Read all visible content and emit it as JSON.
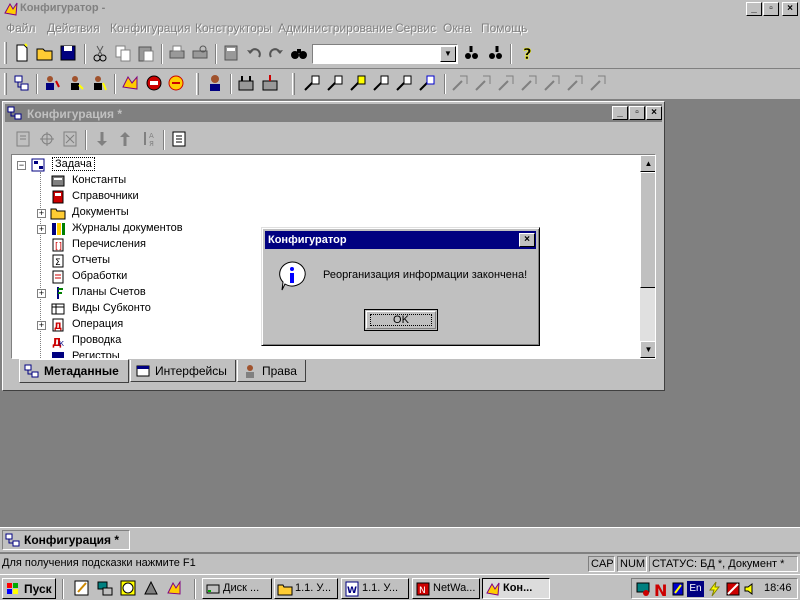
{
  "app": {
    "title": "Конфигуратор -"
  },
  "menu": [
    "Файл",
    "Действия",
    "Конфигурация",
    "Конструкторы",
    "Администрирование",
    "Сервис",
    "Окна",
    "Помощь"
  ],
  "icons": {
    "app": "app-icon",
    "new": "new-file-icon",
    "open": "open-folder-icon",
    "save": "save-icon",
    "cut": "cut-icon",
    "copy": "copy-icon",
    "paste": "paste-icon",
    "print": "print-icon",
    "find": "binoculars-icon",
    "help": "help-icon",
    "info": "info-icon"
  },
  "config_window": {
    "title": "Конфигурация *",
    "root": "Задача",
    "tree": [
      {
        "label": "Константы",
        "expandable": false
      },
      {
        "label": "Справочники",
        "expandable": false
      },
      {
        "label": "Документы",
        "expandable": true
      },
      {
        "label": "Журналы документов",
        "expandable": true
      },
      {
        "label": "Перечисления",
        "expandable": false
      },
      {
        "label": "Отчеты",
        "expandable": false
      },
      {
        "label": "Обработки",
        "expandable": false
      },
      {
        "label": "Планы Счетов",
        "expandable": true
      },
      {
        "label": "Виды Субконто",
        "expandable": false
      },
      {
        "label": "Операция",
        "expandable": true
      },
      {
        "label": "Проводка",
        "expandable": false
      },
      {
        "label": "Регистры",
        "expandable": false
      }
    ],
    "tabs": [
      "Метаданные",
      "Интерфейсы",
      "Права"
    ]
  },
  "dialog": {
    "title": "Конфигуратор",
    "message": "Реорганизация информации закончена!",
    "ok_label": "OK"
  },
  "mdi_tab": "Конфигурация *",
  "status": {
    "hint": "Для получения подсказки нажмите F1",
    "cap": "CAP",
    "num": "NUM",
    "db_status": "СТАТУС: БД *, Документ *"
  },
  "taskbar": {
    "start": "Пуск",
    "tasks": [
      "Диск ...",
      "1.1. У...",
      "1.1. У...",
      "NetWa...",
      "Кон..."
    ],
    "clock": "18:46",
    "lang": "En"
  },
  "colors": {
    "title_active": "#000080",
    "desktop": "#808080",
    "face": "#c0c0c0"
  }
}
